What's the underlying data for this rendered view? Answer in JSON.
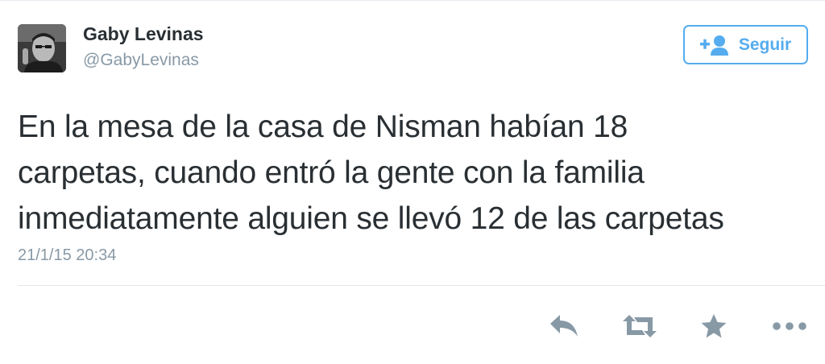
{
  "user": {
    "display_name": "Gaby Levinas",
    "screen_name": "@GabyLevinas"
  },
  "follow_button": {
    "label": "Seguir",
    "icon": "follow-person-plus-icon"
  },
  "tweet": {
    "text": "En la mesa de la casa de Nisman habían 18\ncarpetas, cuando entró la gente con la familia\ninmediatamente alguien se llevó 12 de las carpetas",
    "timestamp": "21/1/15 20:34"
  },
  "actions": [
    {
      "name": "reply",
      "icon": "reply-arrow-icon"
    },
    {
      "name": "retweet",
      "icon": "retweet-icon"
    },
    {
      "name": "favorite",
      "icon": "star-icon"
    },
    {
      "name": "more",
      "icon": "ellipsis-icon"
    }
  ],
  "colors": {
    "accent": "#55acee",
    "text": "#292f33",
    "muted": "#8899a6",
    "icon": "#8899a6",
    "divider": "#e1e8ed"
  }
}
